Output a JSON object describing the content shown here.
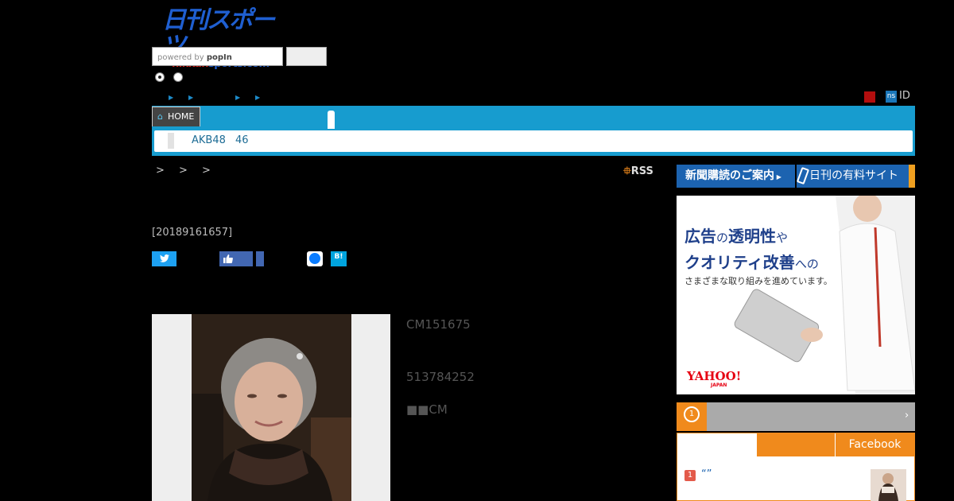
{
  "header": {
    "logo_jp": "日刊スポーツ",
    "logo_en_a": "nikkan",
    "logo_en_b": "sports.com",
    "search_powered": "powered by",
    "search_brand": "popIn"
  },
  "utility": {
    "id_label": "ID",
    "ns_label": "ns"
  },
  "nav": {
    "home_label": "HOME",
    "sub_item_1": "AKB48",
    "sub_item_2": "46"
  },
  "breadcrumbs": "> > >",
  "rss_label": "RSS",
  "article": {
    "date": "[20189161657]",
    "line1": "CM151675",
    "line2": "513784252",
    "line3": "■■CM"
  },
  "sidebar": {
    "subscribe_label": "新聞購読のご案内",
    "paid_label": "日刊の有料サイト",
    "ad": {
      "line1_a": "広告",
      "line1_b": "の",
      "line1_c": "透明性",
      "line1_d": "や",
      "line2_a": "クオリティ改善",
      "line2_b": "への",
      "line3": "さまざまな取り組みを進めています。",
      "logo": "YAHOO!",
      "logo_sub": "JAPAN"
    },
    "ranking": {
      "medal": "1",
      "tab_facebook": "Facebook",
      "item_rank": "1",
      "item_title": "“”"
    }
  },
  "colors": {
    "nav": "#179ccf",
    "brand_blue": "#1c63b0",
    "accent_orange": "#f08a1c"
  }
}
